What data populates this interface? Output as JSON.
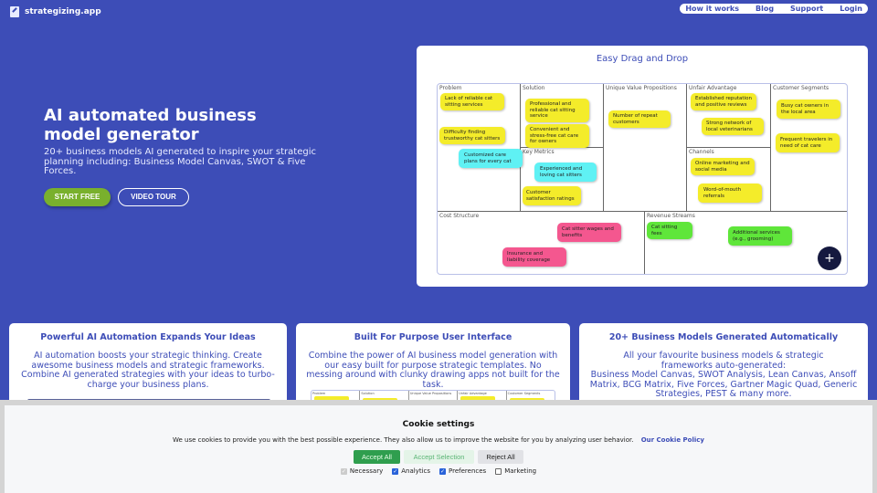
{
  "header": {
    "brand": "strategizing.app",
    "nav": [
      "How it works",
      "Blog",
      "Support",
      "Login"
    ]
  },
  "hero": {
    "title": "AI automated business model generator",
    "subtitle": "20+ business models AI generated to inspire your strategic planning including: Business Model Canvas, SWOT & Five Forces.",
    "start_label": "START FREE",
    "video_label": "VIDEO TOUR"
  },
  "demo": {
    "title": "Easy Drag and Drop",
    "sections": {
      "problem": "Problem",
      "solution": "Solution",
      "key_metrics": "Key Metrics",
      "uvp": "Unique Value Propositions",
      "unfair": "Unfair Advantage",
      "channels": "Channels",
      "segments": "Customer Segments",
      "cost": "Cost Structure",
      "revenue": "Revenue Streams"
    },
    "notes": {
      "p1": "Lack of reliable cat sitting services",
      "p2": "Difficulty finding trustworthy cat sitters",
      "p3": "Customized care plans for every cat",
      "s1": "Professional and reliable cat sitting service",
      "s2": "Convenient and stress-free cat care for owners",
      "k1": "Experienced and loving cat sitters",
      "k2": "Customer satisfaction ratings",
      "u1": "Number of repeat customers",
      "a1": "Established reputation and positive reviews",
      "a2": "Strong network of local veterinarians",
      "ch1": "Online marketing and social media",
      "ch2": "Word-of-mouth referrals",
      "cs1": "Busy cat owners in the local area",
      "cs2": "Frequent travelers in need of cat care",
      "c1": "Cat sitter wages and benefits",
      "c2": "Insurance and liability coverage",
      "r1": "Cat sitting fees",
      "r2": "Additional services (e.g., grooming)"
    },
    "fab": "+"
  },
  "features": [
    {
      "title": "Powerful AI Automation Expands Your Ideas",
      "text": "AI automation boosts your strategic thinking. Create awesome business models and strategic frameworks. Combine AI generated strategies with your ideas to turbo-charge your business plans."
    },
    {
      "title": "Built For Purpose User Interface",
      "text": "Combine the power of AI business model generation with our easy built for purpose strategic templates. No messing around with clunky drawing apps not built for the task.",
      "mini_cols": [
        "Problem",
        "Solution",
        "Unique Value Propositions",
        "Unfair Advantage",
        "Customer Segments"
      ]
    },
    {
      "title": "20+ Business Models Generated Automatically",
      "text": "All your favourite business models & strategic frameworks auto-generated:",
      "text2": "Business Model Canvas, SWOT Analysis, Lean Canvas, Ansoff Matrix, BCG Matrix, Five Forces, Gartner Magic Quad, Generic Strategies, PEST & many more."
    }
  ],
  "cookie": {
    "title": "Cookie settings",
    "text": "We use cookies to provide you with the best possible experience. They also allow us to improve the website for you by analyzing user behavior.",
    "policy_link": "Our Cookie Policy",
    "accept_all": "Accept All",
    "accept_selection": "Accept Selection",
    "reject_all": "Reject All",
    "options": [
      {
        "label": "Necessary",
        "checked": true,
        "disabled": true
      },
      {
        "label": "Analytics",
        "checked": true
      },
      {
        "label": "Preferences",
        "checked": true
      },
      {
        "label": "Marketing",
        "checked": false
      }
    ]
  },
  "colors": {
    "brand": "#3d4db7",
    "start_button": "#79b02d",
    "accept_button": "#2f9e4e"
  }
}
